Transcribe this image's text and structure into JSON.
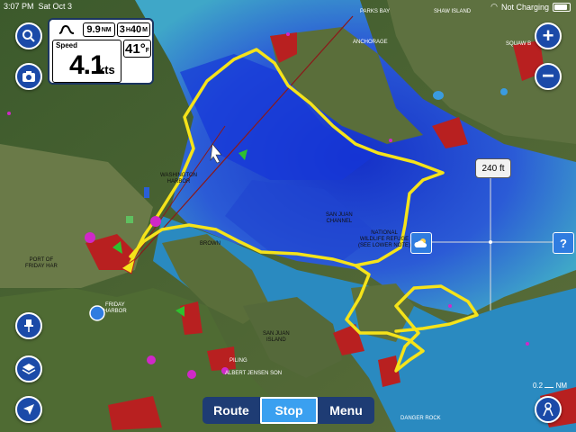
{
  "status_bar": {
    "time": "3:07 PM",
    "date": "Sat Oct 3",
    "battery_text": "Not Charging"
  },
  "info_panel": {
    "distance_value": "9.9",
    "distance_unit": "NM",
    "time_hours": "3",
    "time_hours_unit": "H",
    "time_minutes": "40",
    "time_minutes_unit": "M",
    "speed_label": "Speed",
    "speed_value": "4.1",
    "speed_unit": "kts",
    "temperature_value": "41°",
    "temperature_unit": "F"
  },
  "ruler": {
    "distance_label": "240 ft"
  },
  "help_button": {
    "label": "?"
  },
  "bottom_bar": {
    "route_label": "Route",
    "stop_label": "Stop",
    "menu_label": "Menu"
  },
  "scale_bar": {
    "left_value": "0.2",
    "right_unit": "NM"
  },
  "map_labels": {
    "shaw_island": "SHAW ISLAND",
    "parks_bay": "PARKS BAY",
    "anchorage": "ANCHORAGE",
    "squaw_bay": "SQUAW B",
    "washington_harbor": "WASHINGTON\nHARBOR",
    "san_juan_channel": "SAN JUAN\nCHANNEL",
    "wildlife_refuge": "NATIONAL\nWILDLIFE REFUGE\n(SEE LOWER NOTE)",
    "port_of_friday_harbor": "PORT OF\nFRIDAY HAR",
    "friday_harbor": "FRIDAY\nHARBOR",
    "brown_island": "BROWN",
    "san_juan_island": "SAN JUAN\nISLAND",
    "albert_jensen": "ALBERT JENSEN SON",
    "danger_rock": "DANGER ROCK",
    "pilings": "PILING"
  },
  "colors": {
    "track": "#f5e31a",
    "button_blue": "#1b4aa8",
    "deep_water": "#1d3fc9",
    "shoal": "#2a9cc9",
    "land_red": "#b82020"
  }
}
